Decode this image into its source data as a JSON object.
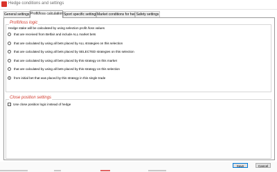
{
  "window": {
    "title": "Hedge conditions and settings",
    "icon": "app-logo-icon"
  },
  "tabs": [
    {
      "label": "General settings",
      "active": false
    },
    {
      "label": "Profit/loss calculation",
      "active": true
    },
    {
      "label": "Sport specific settings",
      "active": false
    },
    {
      "label": "Market conditions for hedge",
      "active": false
    },
    {
      "label": "Safety settings",
      "active": false
    }
  ],
  "profit_loss": {
    "title": "Profit/loss logic",
    "description": "Hedge stake will be calculated by using selection profit /loss values",
    "options": [
      {
        "label": "that are received from Betfair and include ALL market bets",
        "checked": false
      },
      {
        "label": "that are calculated by using all bets placed by ALL strategies on this selection",
        "checked": false
      },
      {
        "label": "that are calculated by using all bets placed by SELECTED strategies on this selection",
        "checked": false
      },
      {
        "label": "that are calculated by using all bets placed by this strategy on this market",
        "checked": false
      },
      {
        "label": "that are calculated by using all bets placed by this strategy on this selection",
        "checked": false
      },
      {
        "label": "from initial bet that was placed by this strategy in this single trade",
        "checked": true
      }
    ]
  },
  "close_position": {
    "title": "Close position settings",
    "checkbox_label": "Use close position logic instead of hedge",
    "checked": false
  },
  "buttons": {
    "save": "Save",
    "cancel": "Cancel"
  },
  "colors": {
    "accent": "#d23b2e",
    "default_button_border": "#0078d7"
  }
}
